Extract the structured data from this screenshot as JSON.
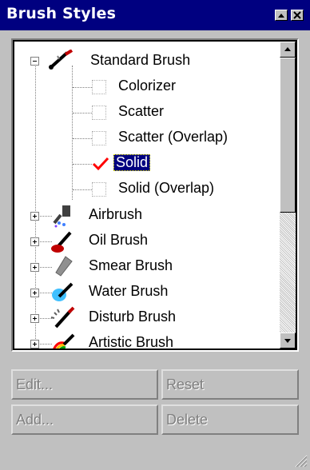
{
  "window": {
    "title": "Brush Styles"
  },
  "tree": {
    "items": [
      {
        "label": "Standard Brush",
        "icon": "standard-brush-icon",
        "expanded": true
      },
      {
        "label": "Colorizer",
        "checked": false
      },
      {
        "label": "Scatter",
        "checked": false
      },
      {
        "label": "Scatter (Overlap)",
        "checked": false
      },
      {
        "label": "Solid",
        "checked": true,
        "selected": true
      },
      {
        "label": "Solid (Overlap)",
        "checked": false
      },
      {
        "label": "Airbrush",
        "icon": "airbrush-icon",
        "expanded": false
      },
      {
        "label": "Oil Brush",
        "icon": "oil-brush-icon",
        "expanded": false
      },
      {
        "label": "Smear Brush",
        "icon": "smear-brush-icon",
        "expanded": false
      },
      {
        "label": "Water Brush",
        "icon": "water-brush-icon",
        "expanded": false
      },
      {
        "label": "Disturb Brush",
        "icon": "disturb-brush-icon",
        "expanded": false
      },
      {
        "label": "Artistic Brush",
        "icon": "artistic-brush-icon",
        "expanded": false
      }
    ]
  },
  "buttons": {
    "edit": "Edit...",
    "reset": "Reset",
    "add": "Add...",
    "delete": "Delete"
  },
  "colors": {
    "title_bar": "#000080",
    "face": "#c0c0c0",
    "selection": "#000080",
    "check": "#ff0000"
  }
}
